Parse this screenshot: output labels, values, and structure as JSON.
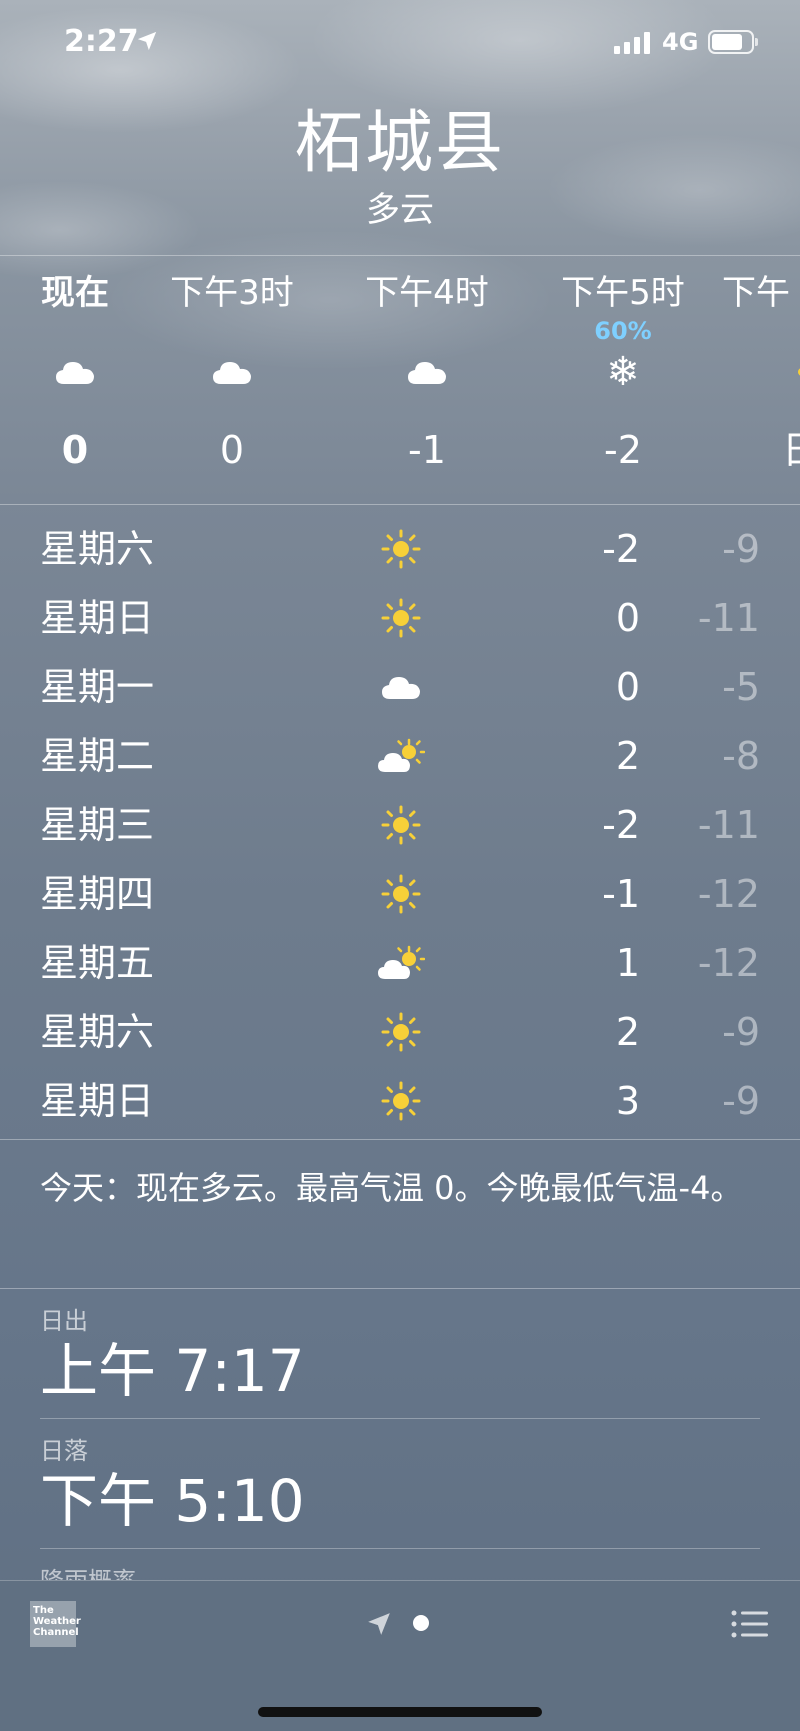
{
  "status_bar": {
    "time": "2:27",
    "network": "4G"
  },
  "header": {
    "city": "柘城县",
    "condition": "多云"
  },
  "hourly": [
    {
      "label": "现在",
      "icon": "cloud-icon",
      "temp": "0",
      "pop": ""
    },
    {
      "label": "下午3时",
      "icon": "cloud-icon",
      "temp": "0",
      "pop": ""
    },
    {
      "label": "下午4时",
      "icon": "cloud-icon",
      "temp": "-1",
      "pop": ""
    },
    {
      "label": "下午5时",
      "icon": "snowflake-icon",
      "temp": "-2",
      "pop": "60%"
    },
    {
      "label": "下午",
      "icon": "sun-icon",
      "temp": "日",
      "pop": ""
    }
  ],
  "daily": [
    {
      "day": "星期六",
      "icon": "sun-icon",
      "high": "-2",
      "low": "-9"
    },
    {
      "day": "星期日",
      "icon": "sun-icon",
      "high": "0",
      "low": "-11"
    },
    {
      "day": "星期一",
      "icon": "cloud-icon",
      "high": "0",
      "low": "-5"
    },
    {
      "day": "星期二",
      "icon": "partly-cloudy-icon",
      "high": "2",
      "low": "-8"
    },
    {
      "day": "星期三",
      "icon": "sun-icon",
      "high": "-2",
      "low": "-11"
    },
    {
      "day": "星期四",
      "icon": "sun-icon",
      "high": "-1",
      "low": "-12"
    },
    {
      "day": "星期五",
      "icon": "partly-cloudy-icon",
      "high": "1",
      "low": "-12"
    },
    {
      "day": "星期六",
      "icon": "sun-icon",
      "high": "2",
      "low": "-9"
    },
    {
      "day": "星期日",
      "icon": "sun-icon",
      "high": "3",
      "low": "-9"
    }
  ],
  "summary": "今天：现在多云。最高气温 0。今晚最低气温-4。",
  "details": {
    "sunrise_label": "日出",
    "sunrise_value": "上午 7:17",
    "sunset_label": "日落",
    "sunset_value": "下午 5:10",
    "next_label": "降雨概率"
  },
  "toolbar": {
    "brand": "The Weather Channel"
  },
  "colors": {
    "precip": "#7fd0ff",
    "sun": "#f7d038"
  }
}
